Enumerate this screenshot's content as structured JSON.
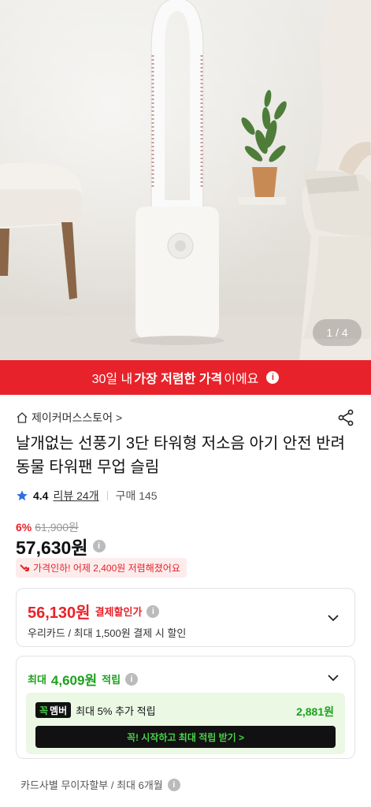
{
  "hero": {
    "counter": "1 / 4"
  },
  "banner": {
    "pre": "30일 내 ",
    "strong": "가장 저렴한 가격",
    "post": "이에요"
  },
  "store": {
    "name": "제이커머스스토어",
    "chevron": ">"
  },
  "product": {
    "title": "날개없는 선풍기 3단 타워형 저소음 아기 안전 반려동물 타워팬 무업 슬림"
  },
  "rating": {
    "score": "4.4",
    "reviews": "리뷰 24개",
    "purchases": "구매 145"
  },
  "pricing": {
    "discount_pct": "6%",
    "original_price": "61,900원",
    "price": "57,630원",
    "drop_notice": "가격인하! 어제 2,400원 저렴해졌어요"
  },
  "payment_discount": {
    "amount": "56,130원",
    "label": "결제할인가",
    "detail": "우리카드 / 최대 1,500원 결제 시 할인"
  },
  "points": {
    "prefix": "최대",
    "amount": "4,609원",
    "suffix": "적립",
    "badge_1": "꼭",
    "badge_2": "멤버",
    "member_text": "최대 5% 추가 적립",
    "member_amount": "2,881원",
    "cta": "꼭! 시작하고 최대 적립 받기 >"
  },
  "installment": {
    "text": "카드사별 무이자할부 / 최대 6개월"
  },
  "colors": {
    "accent": "#e8222a",
    "green": "#1ca21c",
    "star": "#2f6fe0"
  }
}
